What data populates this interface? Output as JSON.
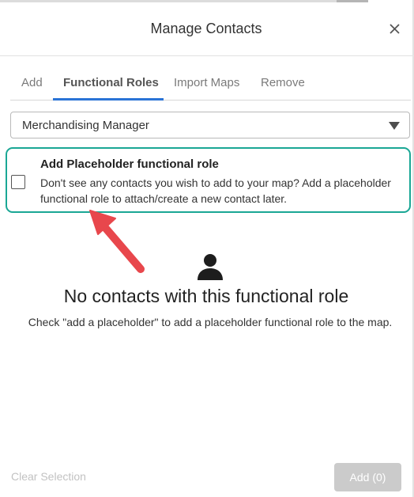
{
  "dialog": {
    "title": "Manage Contacts",
    "close_icon": "close-icon"
  },
  "tabs": [
    {
      "label": "Add",
      "active": false
    },
    {
      "label": "Functional Roles",
      "active": true
    },
    {
      "label": "Import Maps",
      "active": false
    },
    {
      "label": "Remove",
      "active": false
    }
  ],
  "role_select": {
    "value": "Merchandising Manager",
    "icon": "caret-down-icon"
  },
  "placeholder_option": {
    "checked": false,
    "title": "Add Placeholder functional role",
    "description": "Don't see any contacts you wish to add to your map? Add a placeholder functional role to attach/create a new contact later."
  },
  "empty_state": {
    "icon": "person-icon",
    "title": "No contacts with this functional role",
    "description": "Check \"add a placeholder\" to add a placeholder functional role to the map."
  },
  "footer": {
    "clear_label": "Clear Selection",
    "add_label": "Add (0)"
  },
  "colors": {
    "highlight_border": "#1aa795",
    "active_tab_underline": "#2a73d6",
    "annotation_arrow": "#e8474c",
    "disabled_button": "#cbcbcb"
  }
}
